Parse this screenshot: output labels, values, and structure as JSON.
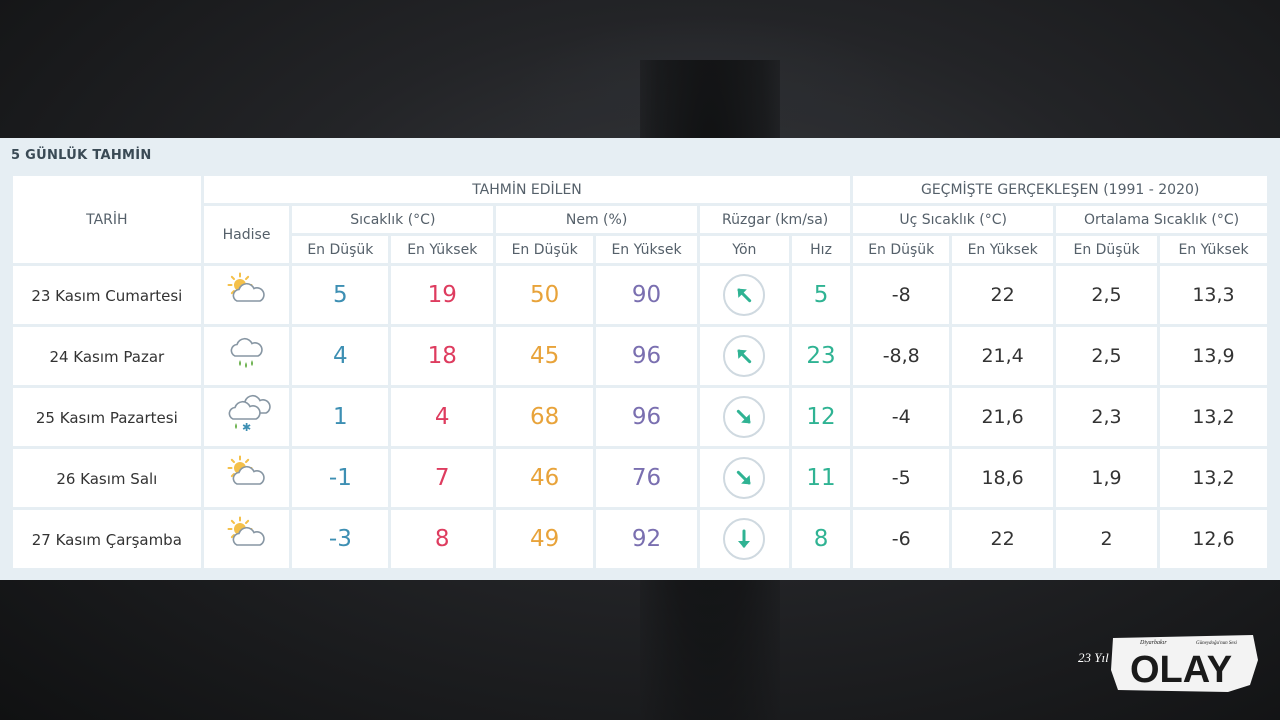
{
  "title": "5 GÜNLÜK TAHMİN",
  "header": {
    "date_col": "TARİH",
    "forecast_group": "TAHMİN EDİLEN",
    "history_group": "GEÇMİŞTE GERÇEKLEŞEN (1991 - 2020)",
    "event": "Hadise",
    "temp": "Sıcaklık (°C)",
    "humidity": "Nem (%)",
    "wind": "Rüzgar (km/sa)",
    "extreme_temp": "Uç Sıcaklık (°C)",
    "avg_temp": "Ortalama Sıcaklık (°C)",
    "min": "En Düşük",
    "max": "En Yüksek",
    "direction": "Yön",
    "speed": "Hız"
  },
  "rows": [
    {
      "date": "23 Kasım Cumartesi",
      "icon": "partly-cloudy-icon",
      "tmin": "5",
      "tmax": "19",
      "hmin": "50",
      "hmax": "90",
      "wdir": 315,
      "wspd": "5",
      "emin": "-8",
      "emax": "22",
      "amin": "2,5",
      "amax": "13,3"
    },
    {
      "date": "24 Kasım Pazar",
      "icon": "rain-cloud-icon",
      "tmin": "4",
      "tmax": "18",
      "hmin": "45",
      "hmax": "96",
      "wdir": 315,
      "wspd": "23",
      "emin": "-8,8",
      "emax": "21,4",
      "amin": "2,5",
      "amax": "13,9"
    },
    {
      "date": "25 Kasım Pazartesi",
      "icon": "sleet-cloud-icon",
      "tmin": "1",
      "tmax": "4",
      "hmin": "68",
      "hmax": "96",
      "wdir": 135,
      "wspd": "12",
      "emin": "-4",
      "emax": "21,6",
      "amin": "2,3",
      "amax": "13,2"
    },
    {
      "date": "26 Kasım Salı",
      "icon": "partly-cloudy-icon",
      "tmin": "-1",
      "tmax": "7",
      "hmin": "46",
      "hmax": "76",
      "wdir": 135,
      "wspd": "11",
      "emin": "-5",
      "emax": "18,6",
      "amin": "1,9",
      "amax": "13,2"
    },
    {
      "date": "27 Kasım Çarşamba",
      "icon": "partly-cloudy-icon",
      "tmin": "-3",
      "tmax": "8",
      "hmin": "49",
      "hmax": "92",
      "wdir": 180,
      "wspd": "8",
      "emin": "-6",
      "emax": "22",
      "amin": "2",
      "amax": "12,6"
    }
  ],
  "logo": {
    "text": "OLAY",
    "tagline": "Diyarbakır",
    "tagline2": "Güneydoğu'nun Sesi",
    "years": "23 Yıl"
  },
  "colors": {
    "min": "#3d8fb3",
    "max": "#de3c5f",
    "hum_min": "#e8a33a",
    "hum_max": "#7a6fb0",
    "wind": "#2fb393"
  }
}
